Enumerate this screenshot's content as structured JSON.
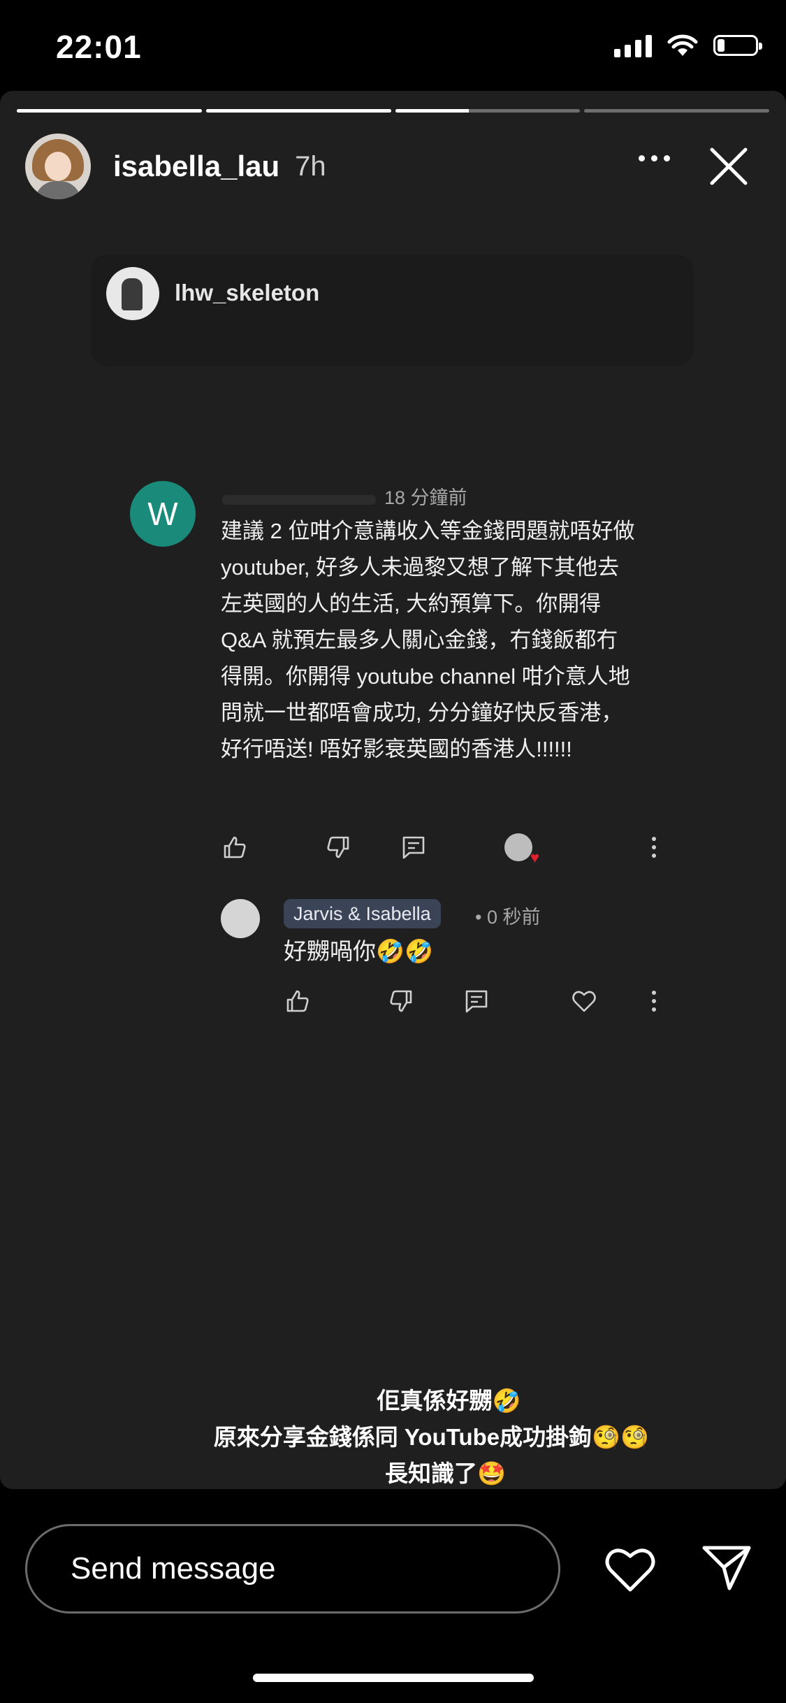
{
  "status_bar": {
    "time": "22:01",
    "battery_level": 0.2
  },
  "story": {
    "progress": [
      1.0,
      1.0,
      0.4,
      0.0
    ],
    "username": "isabella_lau",
    "time_ago": "7h"
  },
  "card": {
    "username": "lhw_skeleton"
  },
  "comment": {
    "avatar_letter": "W",
    "time": "18 分鐘前",
    "lines": [
      "建議 2 位咁介意講收入等金錢問題就唔好做",
      "youtuber, 好多人未過黎又想了解下其他去",
      "左英國的人的生活, 大約預算下。你開得",
      "Q&A 就預左最多人關心金錢，冇錢飯都冇",
      "得開。你開得 youtube channel 咁介意人地",
      "問就一世都唔會成功, 分分鐘好快反香港，",
      "好行唔送! 唔好影衰英國的香港人!!!!!!"
    ]
  },
  "reply": {
    "author": "Jarvis & Isabella",
    "time": "• 0 秒前",
    "text": "好嬲喎你🤣🤣"
  },
  "caption": {
    "line1": "佢真係好嬲🤣",
    "line2": "原來分享金錢係同 YouTube成功掛鉤🧐🧐",
    "line3": "長知識了🤩"
  },
  "bottom": {
    "send_placeholder": "Send message"
  }
}
